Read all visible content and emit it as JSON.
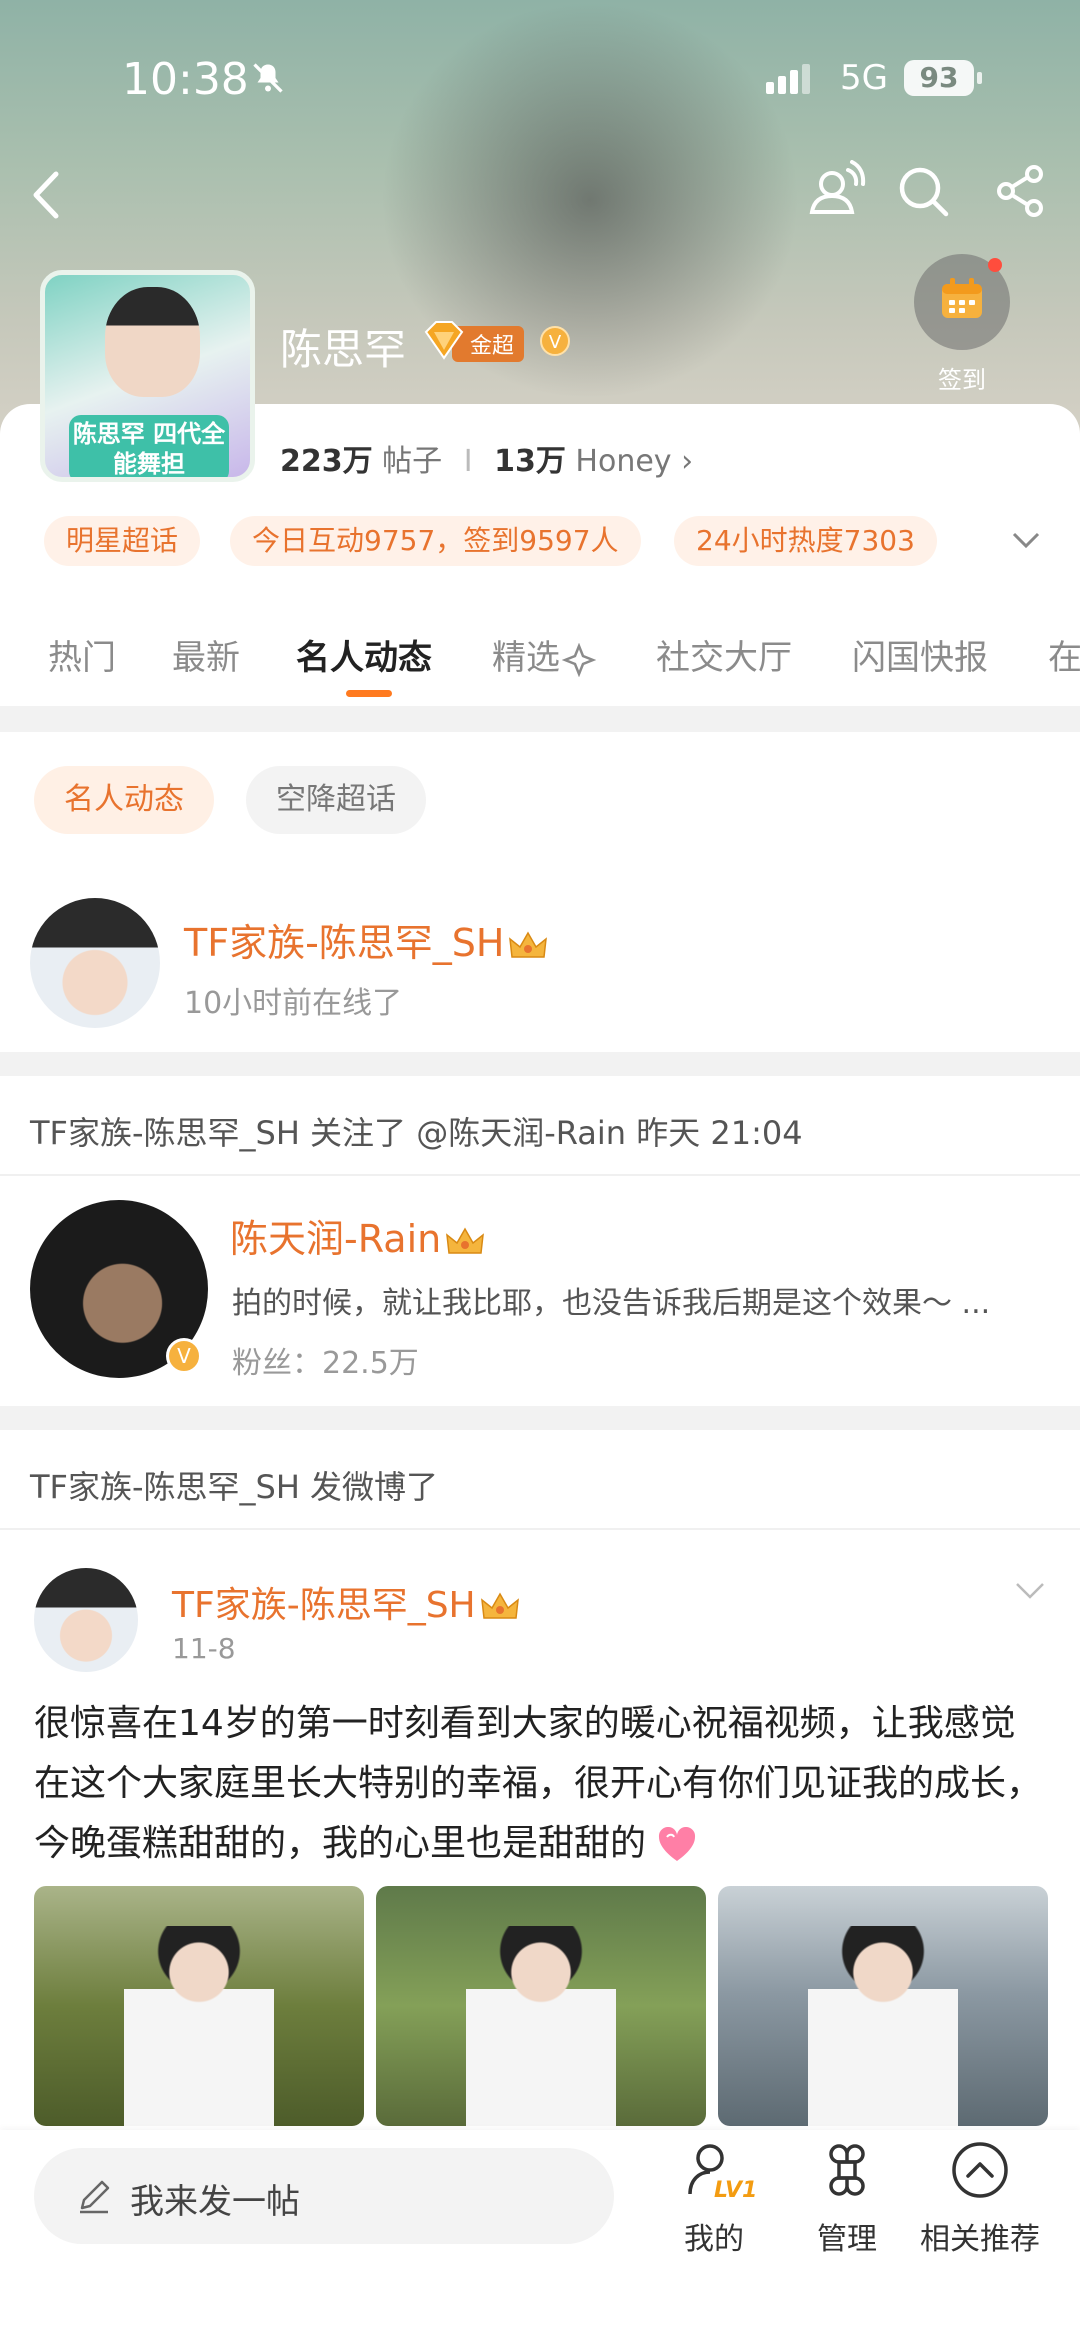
{
  "status_bar": {
    "time": "10:38",
    "network": "5G",
    "battery": "93"
  },
  "header": {
    "name": "陈思罕",
    "tier_badge": "金超",
    "avatar_banner": "陈思罕 四代全能舞担",
    "checkin_label": "签到",
    "stats": {
      "posts_count": "223万",
      "posts_label": "帖子",
      "honey_count": "13万",
      "honey_label": "Honey"
    }
  },
  "chips": [
    "明星超话",
    "今日互动9757，签到9597人",
    "24小时热度7303"
  ],
  "tabs": [
    "热门",
    "最新",
    "名人动态",
    "精选",
    "社交大厅",
    "闪国快报",
    "在"
  ],
  "active_tab": "名人动态",
  "sub_tabs": [
    "名人动态",
    "空降超话"
  ],
  "online_user": {
    "name": "TF家族-陈思罕_SH",
    "status": "10小时前在线了"
  },
  "follow_activity": {
    "headline": "TF家族-陈思罕_SH 关注了 @陈天润-Rain 昨天 21:04",
    "user_name": "陈天润-Rain",
    "bio": "拍的时候，就让我比耶，也没告诉我后期是这个效果～ ...",
    "fans": "粉丝：22.5万"
  },
  "post_activity": {
    "headline": "TF家族-陈思罕_SH 发微博了",
    "author": "TF家族-陈思罕_SH",
    "date": "11-8",
    "text": "很惊喜在14岁的第一时刻看到大家的暖心祝福视频，让我感觉在这个大家庭里长大特别的幸福，很开心有你们见证我的成长，今晚蛋糕甜甜的，我的心里也是甜甜的"
  },
  "bottom_bar": {
    "compose_placeholder": "我来发一帖",
    "level": "LV1",
    "mine": "我的",
    "manage": "管理",
    "recommend": "相关推荐"
  },
  "colors": {
    "accent": "#e8732e",
    "tab_indicator": "#ff7a1f",
    "chip_bg": "#fff1e8"
  }
}
